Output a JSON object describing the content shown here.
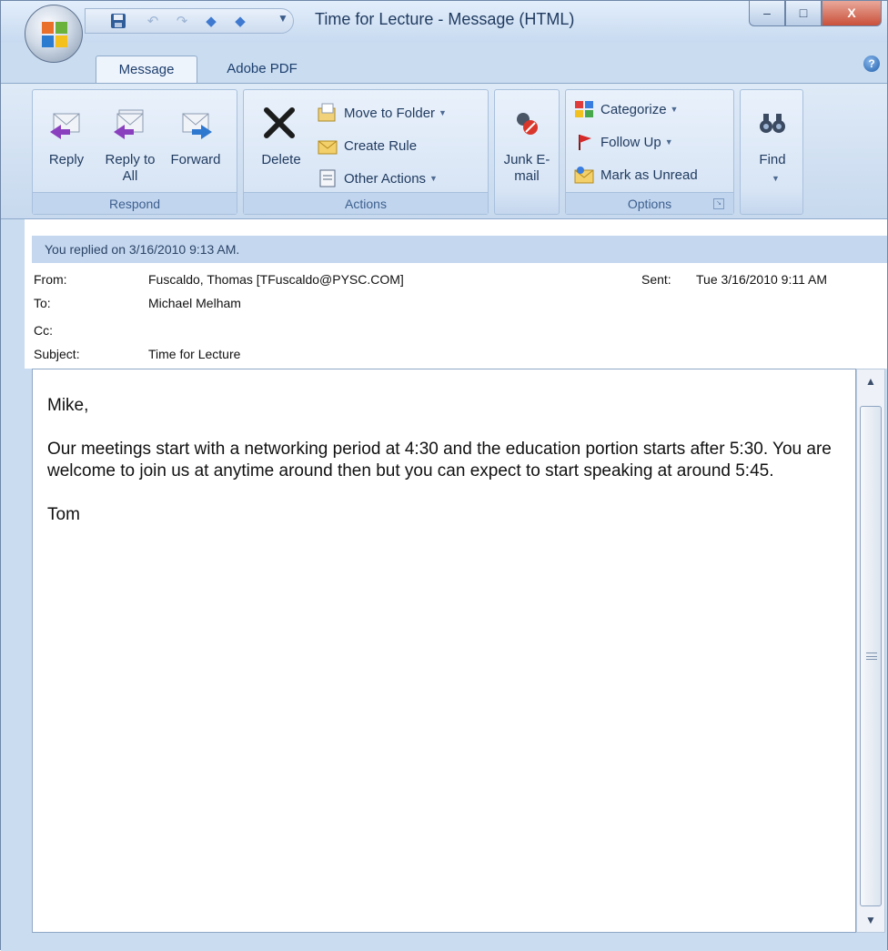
{
  "window": {
    "title": "Time for Lecture - Message (HTML)",
    "controls": {
      "minimize": "–",
      "maximize": "□",
      "close": "X"
    }
  },
  "tabs": [
    {
      "label": "Message",
      "active": true
    },
    {
      "label": "Adobe PDF",
      "active": false
    }
  ],
  "ribbon": {
    "respond": {
      "label": "Respond",
      "reply": "Reply",
      "reply_all": "Reply to All",
      "forward": "Forward"
    },
    "actions": {
      "label": "Actions",
      "delete": "Delete",
      "move_to_folder": "Move to Folder",
      "create_rule": "Create Rule",
      "other_actions": "Other Actions"
    },
    "junk": {
      "label": "Junk E-mail"
    },
    "options": {
      "label": "Options",
      "categorize": "Categorize",
      "follow_up": "Follow Up",
      "mark_unread": "Mark as Unread"
    },
    "find": {
      "label": "Find"
    }
  },
  "banner": "You replied on 3/16/2010 9:13 AM.",
  "header": {
    "from_label": "From:",
    "from_value": "Fuscaldo, Thomas [TFuscaldo@PYSC.COM]",
    "sent_label": "Sent:",
    "sent_value": "Tue 3/16/2010 9:11 AM",
    "to_label": "To:",
    "to_value": "Michael Melham",
    "cc_label": "Cc:",
    "cc_value": "",
    "subject_label": "Subject:",
    "subject_value": "Time for Lecture"
  },
  "body": {
    "greeting": "Mike,",
    "paragraph": "Our meetings start with a networking period at 4:30 and the education portion starts after 5:30. You are welcome to join us at anytime around then but you can expect to start speaking at around 5:45.",
    "signature": "Tom"
  },
  "colors": {
    "accent": "#1f3a5f",
    "ribbon_bg": "#dfeaf7",
    "banner_bg": "#c4d7ef"
  }
}
